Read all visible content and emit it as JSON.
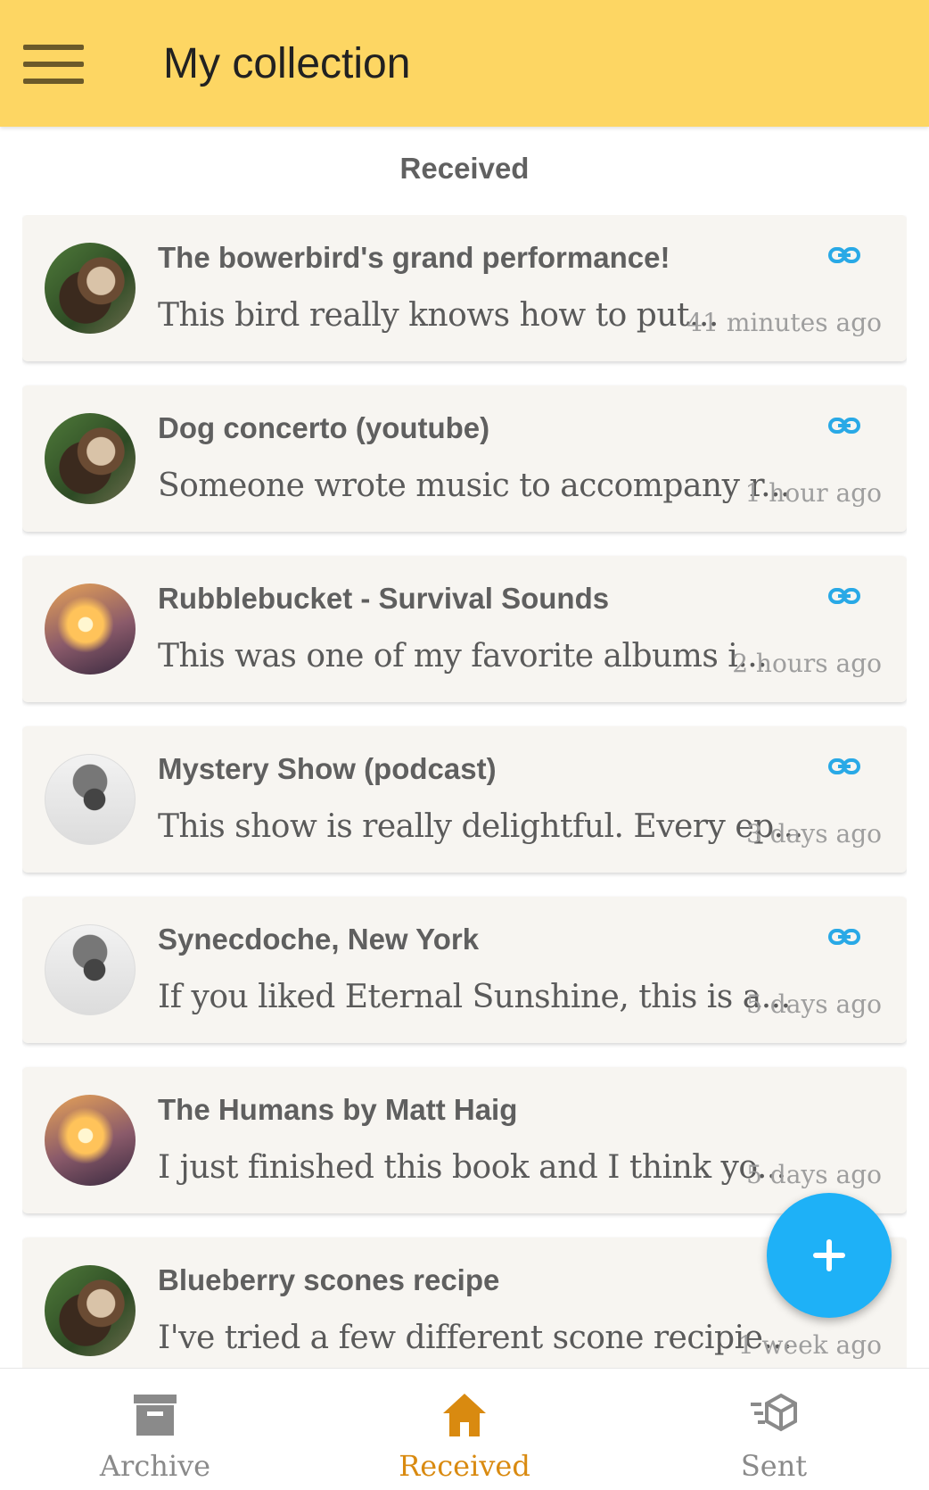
{
  "app": {
    "title": "My collection"
  },
  "section_header": "Received",
  "items": [
    {
      "title": "The bowerbird's grand performance!",
      "text": "This bird really knows how to put...",
      "time": "41 minutes ago",
      "avatar": "av-a"
    },
    {
      "title": "Dog concerto (youtube)",
      "text": "Someone wrote music to accompany r...",
      "time": "1 hour ago",
      "avatar": "av-a"
    },
    {
      "title": "Rubblebucket - Survival Sounds",
      "text": "This was one of my favorite albums i...",
      "time": "2 hours ago",
      "avatar": "av-b"
    },
    {
      "title": "Mystery Show (podcast)",
      "text": "This show is really delightful. Every ep...",
      "time": "3 days ago",
      "avatar": "av-c"
    },
    {
      "title": "Synecdoche, New York",
      "text": "If you liked Eternal Sunshine, this is a...",
      "time": "5 days ago",
      "avatar": "av-c"
    },
    {
      "title": "The Humans by Matt Haig",
      "text": "I just finished this book and I think yo...",
      "time": "5 days ago",
      "avatar": "av-b"
    },
    {
      "title": "Blueberry scones recipe",
      "text": "I've tried a few different scone recipie...",
      "time": "1 week ago",
      "avatar": "av-a"
    }
  ],
  "bottom_nav": {
    "archive": "Archive",
    "received": "Received",
    "sent": "Sent",
    "active": "received"
  },
  "colors": {
    "appbar": "#fdd663",
    "accent_link": "#29a9e6",
    "fab": "#1eb1f7",
    "nav_active": "#d98a10",
    "nav_inactive": "#8a8a8a"
  },
  "icons": {
    "menu": "menu-icon",
    "link": "link-icon",
    "fab": "plus-icon",
    "archive": "archive-icon",
    "received": "home-icon",
    "sent": "sent-icon"
  }
}
